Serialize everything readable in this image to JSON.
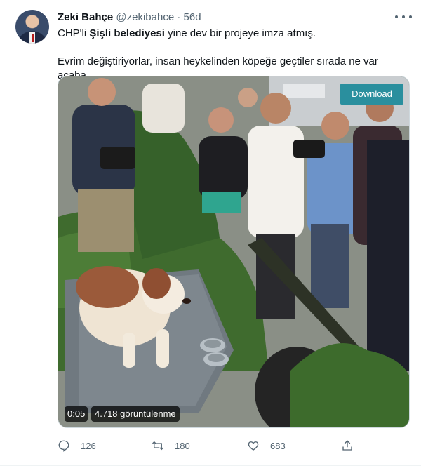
{
  "tweet": {
    "author_name": "Zeki Bahçe",
    "author_handle": "@zekibahce",
    "separator": "·",
    "time": "56d",
    "text_line1_pre": "CHP'li ",
    "text_line1_bold": "Şişli belediyesi",
    "text_line1_post": " yine dev bir projeye imza atmış.",
    "text_line2": "Evrim değiştiriyorlar, insan heykelinden köpeğe geçtiler sırada ne var acaba."
  },
  "media": {
    "download_label": "Download",
    "time": "0:05",
    "views": "4.718 görüntülenme"
  },
  "actions": {
    "replies": "126",
    "retweets": "180",
    "likes": "683"
  },
  "icons": [
    "more-icon",
    "reply-icon",
    "retweet-icon",
    "like-icon",
    "share-icon"
  ],
  "colors": {
    "accent": "#1d9bf0",
    "muted": "#536471",
    "download": "#2a8f9e"
  }
}
